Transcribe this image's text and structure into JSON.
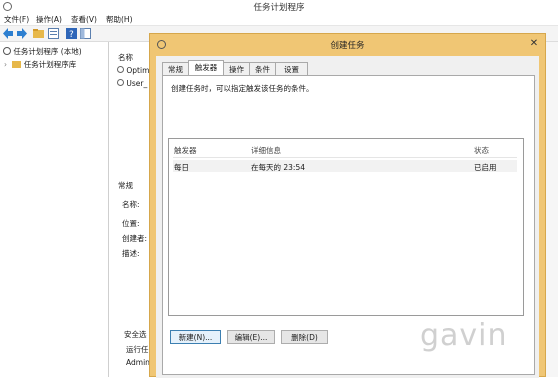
{
  "main": {
    "title": "任务计划程序",
    "menu": [
      "文件(F)",
      "操作(A)",
      "查看(V)",
      "帮助(H)"
    ],
    "tree": [
      "任务计划程序 (本地)",
      "任务计划程序库"
    ],
    "list_header": "名称",
    "list_items": [
      "Optim",
      "User_"
    ],
    "detail_tab": "常规",
    "detail_labels": [
      "名称:",
      "位置:",
      "创建者:",
      "描述:"
    ],
    "security_label": "安全选",
    "run_label": "运行任",
    "admin_label": "Admin"
  },
  "dialog": {
    "title": "创建任务",
    "tabs": [
      "常规",
      "触发器",
      "操作",
      "条件",
      "设置"
    ],
    "active_tab": 1,
    "description": "创建任务时，可以指定触发该任务的条件。",
    "columns": [
      "触发器",
      "详细信息",
      "状态"
    ],
    "rows": [
      {
        "trigger": "每日",
        "details": "在每天的 23:54",
        "status": "已启用"
      }
    ],
    "buttons": {
      "new": "新建(N)...",
      "edit": "编辑(E)...",
      "delete": "删除(D)"
    }
  },
  "watermark": "gavin",
  "colors": {
    "dialog_frame": "#f0c674",
    "selected_button": "#3c7fb1"
  },
  "icons": {
    "clock": "clock-icon",
    "back": "back-arrow-icon",
    "forward": "forward-arrow-icon"
  }
}
